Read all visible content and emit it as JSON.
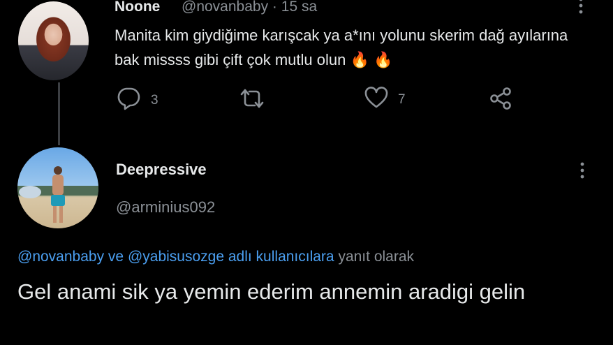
{
  "tweet1": {
    "name": "Noone",
    "handle": "@novanbaby",
    "separator": "·",
    "time": "15 sa",
    "text": "Manita kim giydiğime karışcak ya a*ını yolunu skerim dağ ayılarına bak missss gibi çift çok mutlu olun 🔥 🔥",
    "actions": {
      "reply_count": "3",
      "retweet_count": "",
      "like_count": "7"
    }
  },
  "tweet2": {
    "name": "Deepressive",
    "handle": "@arminius092",
    "replying_to": {
      "user1": "@novanbaby",
      "connector": "ve",
      "user2": "@yabisusozge",
      "suffix_link": "adlı kullanıcılara",
      "suffix_text": "yanıt olarak"
    },
    "text": "Gel anami sik ya yemin ederim annemin aradigi gelin"
  },
  "icons": {
    "more": "more-vertical-icon",
    "reply": "reply-icon",
    "retweet": "retweet-icon",
    "like": "heart-icon",
    "share": "share-icon"
  },
  "colors": {
    "background": "#000000",
    "text": "#e7e9ea",
    "muted": "#8b9096",
    "link": "#4b9ff0"
  }
}
